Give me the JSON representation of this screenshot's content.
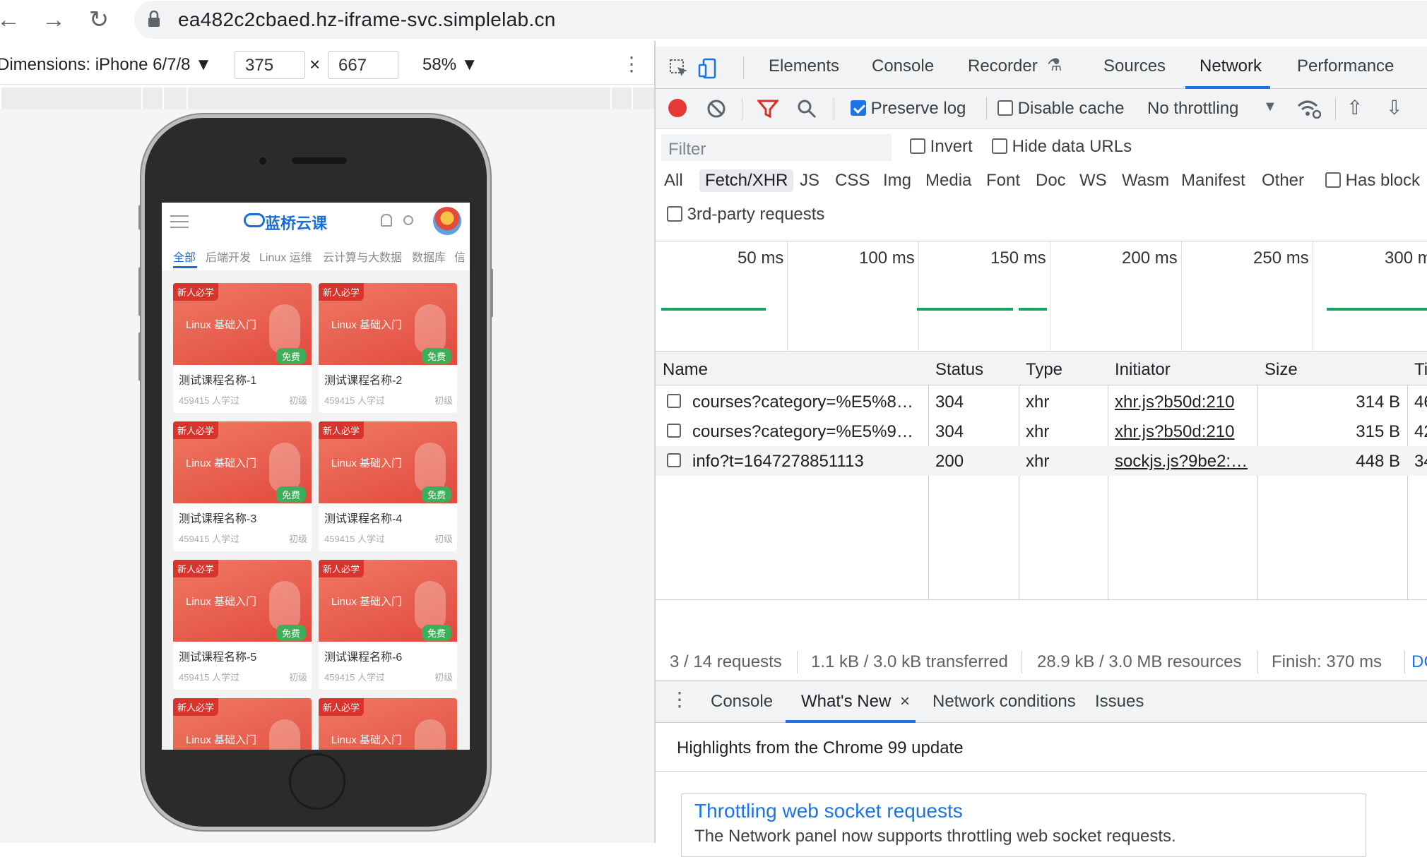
{
  "browser": {
    "url": "ea482c2cbaed.hz-iframe-svc.simplelab.cn"
  },
  "emulation": {
    "device": "Dimensions: iPhone 6/7/8 ▼",
    "width": "375",
    "times": "×",
    "height": "667",
    "zoom": "58% ▼"
  },
  "mobile": {
    "logo": "蓝桥云课",
    "tabs": [
      "全部",
      "后端开发",
      "Linux 运维",
      "云计算与大数据",
      "数据库",
      "信"
    ],
    "courses": [
      {
        "tag": "新人必学",
        "thumb_title": "Linux 基础入门",
        "badge": "免费",
        "name": "测试课程名称-1",
        "learners": "459415 人学过",
        "level": "初级"
      },
      {
        "tag": "新人必学",
        "thumb_title": "Linux 基础入门",
        "badge": "免费",
        "name": "测试课程名称-2",
        "learners": "459415 人学过",
        "level": "初级"
      },
      {
        "tag": "新人必学",
        "thumb_title": "Linux 基础入门",
        "badge": "免费",
        "name": "测试课程名称-3",
        "learners": "459415 人学过",
        "level": "初级"
      },
      {
        "tag": "新人必学",
        "thumb_title": "Linux 基础入门",
        "badge": "免费",
        "name": "测试课程名称-4",
        "learners": "459415 人学过",
        "level": "初级"
      },
      {
        "tag": "新人必学",
        "thumb_title": "Linux 基础入门",
        "badge": "免费",
        "name": "测试课程名称-5",
        "learners": "459415 人学过",
        "level": "初级"
      },
      {
        "tag": "新人必学",
        "thumb_title": "Linux 基础入门",
        "badge": "免费",
        "name": "测试课程名称-6",
        "learners": "459415 人学过",
        "level": "初级"
      },
      {
        "tag": "新人必学",
        "thumb_title": "Linux 基础入门",
        "badge": "",
        "name": "",
        "learners": "",
        "level": ""
      },
      {
        "tag": "新人必学",
        "thumb_title": "Linux 基础入门",
        "badge": "",
        "name": "",
        "learners": "",
        "level": ""
      }
    ]
  },
  "devtools": {
    "tabs": [
      "Elements",
      "Console",
      "Recorder",
      "Sources",
      "Network",
      "Performance"
    ],
    "active_tab": "Network",
    "toolbar": {
      "preserve_log": "Preserve log",
      "disable_cache": "Disable cache",
      "throttling": "No throttling"
    },
    "filter": {
      "placeholder": "Filter",
      "invert": "Invert",
      "hide_data_urls": "Hide data URLs",
      "types": [
        "All",
        "Fetch/XHR",
        "JS",
        "CSS",
        "Img",
        "Media",
        "Font",
        "Doc",
        "WS",
        "Wasm",
        "Manifest",
        "Other"
      ],
      "active_type": "Fetch/XHR",
      "has_blocked": "Has block",
      "third_party": "3rd-party requests"
    },
    "timeline_ticks": [
      "50 ms",
      "100 ms",
      "150 ms",
      "200 ms",
      "250 ms",
      "300 m"
    ],
    "columns": [
      "Name",
      "Status",
      "Type",
      "Initiator",
      "Size",
      "Ti"
    ],
    "requests": [
      {
        "name": "courses?category=%E5%8…",
        "status": "304",
        "type": "xhr",
        "initiator": "xhr.js?b50d:210",
        "size": "314 B",
        "time": "46"
      },
      {
        "name": "courses?category=%E5%9…",
        "status": "304",
        "type": "xhr",
        "initiator": "xhr.js?b50d:210",
        "size": "315 B",
        "time": "42"
      },
      {
        "name": "info?t=1647278851113",
        "status": "200",
        "type": "xhr",
        "initiator": "sockjs.js?9be2:…",
        "size": "448 B",
        "time": "34"
      }
    ],
    "status_bar": {
      "requests": "3 / 14 requests",
      "transferred": "1.1 kB / 3.0 kB transferred",
      "resources": "28.9 kB / 3.0 MB resources",
      "finish": "Finish: 370 ms",
      "dcl": "DC"
    },
    "drawer": {
      "tabs": [
        "Console",
        "What's New",
        "Network conditions",
        "Issues"
      ],
      "active_tab": "What's New",
      "close_glyph": "×",
      "highlights": "Highlights from the Chrome 99 update",
      "article_title": "Throttling web socket requests",
      "article_body": "The Network panel now supports throttling web socket requests."
    }
  }
}
